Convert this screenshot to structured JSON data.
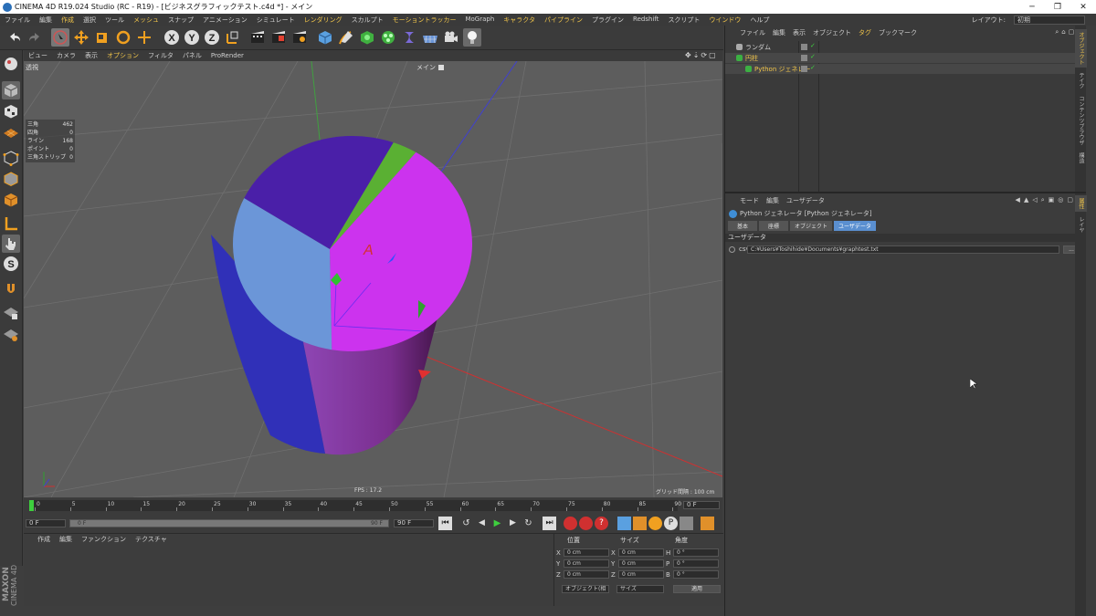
{
  "window": {
    "title": "CINEMA 4D R19.024 Studio (RC - R19) - [ビジネスグラフィックテスト.c4d *] - メイン",
    "minimize": "─",
    "restore": "❐",
    "close": "✕"
  },
  "menu": {
    "items": [
      "ファイル",
      "編集",
      "作成",
      "選択",
      "ツール",
      "メッシュ",
      "スナップ",
      "アニメーション",
      "シミュレート",
      "レンダリング",
      "スカルプト",
      "モーショントラッカー",
      "MoGraph",
      "キャラクタ",
      "パイプライン",
      "プラグイン",
      "Redshift",
      "スクリプト",
      "ウインドウ",
      "ヘルプ"
    ],
    "highlighted": [
      "作成",
      "メッシュ",
      "レンダリング",
      "モーショントラッカー",
      "キャラクタ",
      "パイプライン",
      "ウインドウ"
    ],
    "layout_label": "レイアウト:",
    "layout_value": "初期"
  },
  "viewport": {
    "menu": [
      "ビュー",
      "カメラ",
      "表示",
      "オプション",
      "フィルタ",
      "パネル",
      "ProRender"
    ],
    "menu_highlight": "オプション",
    "camera_label": "透視",
    "main_label": "メイン",
    "stats": [
      {
        "k": "三角",
        "v": "462"
      },
      {
        "k": "四角",
        "v": "0"
      },
      {
        "k": "ライン",
        "v": "168"
      },
      {
        "k": "ポイント",
        "v": "0"
      },
      {
        "k": "三角ストリップ",
        "v": "0"
      }
    ],
    "fps": "FPS : 17.2",
    "grid": "グリッド間隔 : 100 cm",
    "pie_colors": [
      "#4a1fa8",
      "#5ab033",
      "#cc33ee",
      "#6b96d8"
    ]
  },
  "timeline": {
    "ticks": [
      "0",
      "5",
      "10",
      "15",
      "20",
      "25",
      "30",
      "35",
      "40",
      "45",
      "50",
      "55",
      "60",
      "65",
      "70",
      "75",
      "80",
      "85",
      "90"
    ],
    "frame_end": "0 F",
    "start": "0 F",
    "range_start": "0 F",
    "range_end": "90 F",
    "end": "90 F"
  },
  "material": {
    "menu": [
      "作成",
      "編集",
      "ファンクション",
      "テクスチャ"
    ]
  },
  "coords": {
    "headers": [
      "位置",
      "サイズ",
      "角度"
    ],
    "rows": [
      {
        "a": "X",
        "av": "0 cm",
        "b": "X",
        "bv": "0 cm",
        "c": "H",
        "cv": "0 °"
      },
      {
        "a": "Y",
        "av": "0 cm",
        "b": "Y",
        "bv": "0 cm",
        "c": "P",
        "cv": "0 °"
      },
      {
        "a": "Z",
        "av": "0 cm",
        "b": "Z",
        "bv": "0 cm",
        "c": "B",
        "cv": "0 °"
      }
    ],
    "mode": "オブジェクト(相",
    "size_mode": "サイズ",
    "apply": "適用"
  },
  "object_manager": {
    "menu": [
      "ファイル",
      "編集",
      "表示",
      "オブジェクト",
      "タグ",
      "ブックマーク"
    ],
    "menu_highlight": "タグ",
    "objects": [
      {
        "name": "ランダム",
        "color": "#cfcfcf",
        "indent": 0
      },
      {
        "name": "円柱",
        "color": "#f2c64a",
        "indent": 0
      },
      {
        "name": "Python ジェネレー",
        "color": "#f2c64a",
        "indent": 1
      }
    ],
    "side_tabs": [
      "オブジェクト",
      "テイク",
      "コンテンツブラウザ",
      "構造"
    ]
  },
  "attribute_manager": {
    "menu": [
      "モード",
      "編集",
      "ユーザデータ"
    ],
    "title": "Python ジェネレータ [Python ジェネレータ]",
    "tabs": [
      "基本",
      "座標",
      "オブジェクト",
      "ユーザデータ"
    ],
    "active_tab": "ユーザデータ",
    "section": "ユーザデータ",
    "field_label": "csv",
    "field_value": "C:¥Users¥Toshihide¥Documents¥graphtest.txt",
    "browse": "...",
    "side_tabs": [
      "属性",
      "レイヤ"
    ]
  },
  "brand": {
    "name": "MAXON",
    "product": "CINEMA 4D"
  }
}
